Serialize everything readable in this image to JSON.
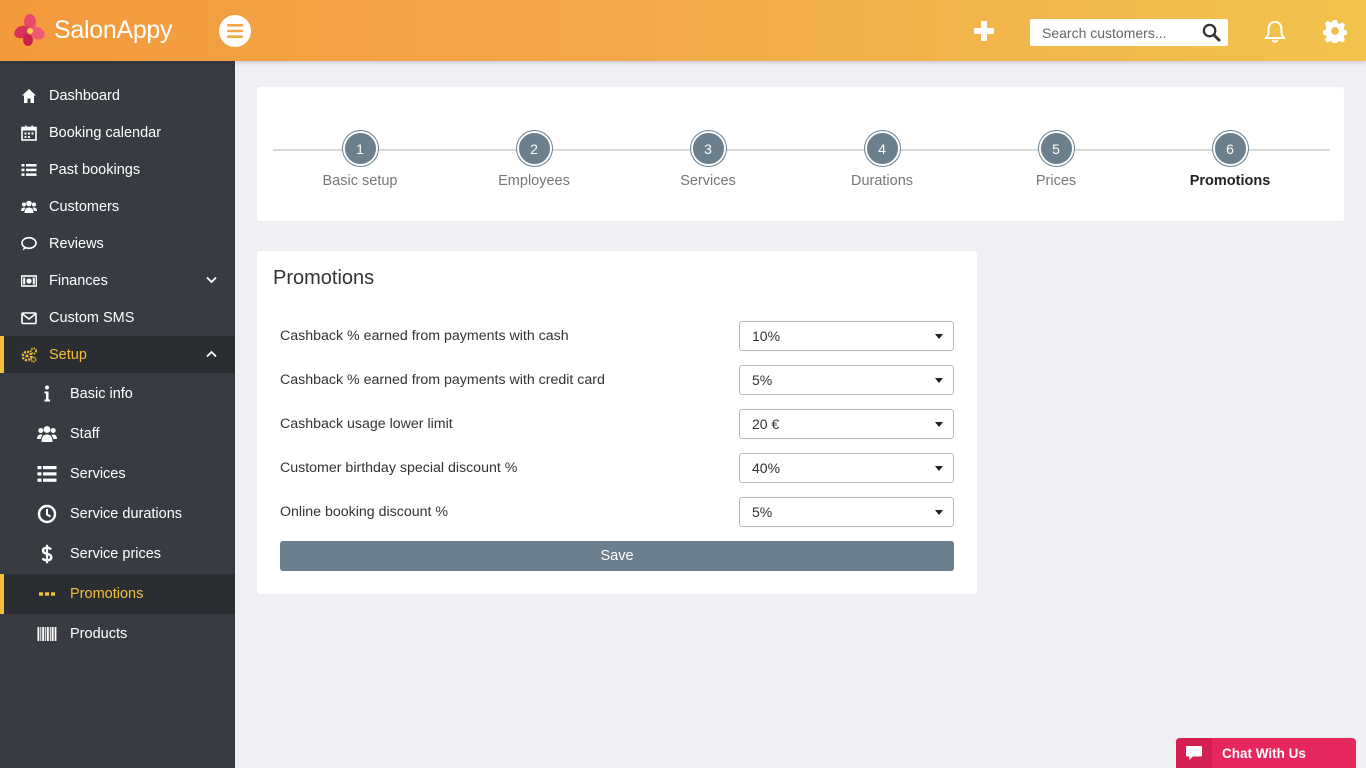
{
  "header": {
    "brand": "SalonAppy",
    "search_placeholder": "Search customers...",
    "icons": {
      "menu": "hamburger-icon",
      "add": "plus-icon",
      "search": "search-icon",
      "notifications": "bell-icon",
      "settings": "gear-icon"
    },
    "colors": {
      "gradient_start": "#f39a3c",
      "gradient_end": "#f2c34d"
    }
  },
  "sidebar": {
    "items": [
      {
        "label": "Dashboard",
        "icon": "home-icon"
      },
      {
        "label": "Booking calendar",
        "icon": "calendar-icon"
      },
      {
        "label": "Past bookings",
        "icon": "list-icon"
      },
      {
        "label": "Customers",
        "icon": "users-icon"
      },
      {
        "label": "Reviews",
        "icon": "comment-icon"
      },
      {
        "label": "Finances",
        "icon": "money-icon"
      },
      {
        "label": "Custom SMS",
        "icon": "envelope-icon"
      },
      {
        "label": "Setup",
        "icon": "cogs-icon"
      }
    ],
    "sub_items": [
      {
        "label": "Basic info",
        "icon": "info-icon"
      },
      {
        "label": "Staff",
        "icon": "users-icon"
      },
      {
        "label": "Services",
        "icon": "list-icon"
      },
      {
        "label": "Service durations",
        "icon": "clock-icon"
      },
      {
        "label": "Service prices",
        "icon": "dollar-icon"
      },
      {
        "label": "Promotions",
        "icon": "ellipsis-icon"
      },
      {
        "label": "Products",
        "icon": "barcode-icon"
      }
    ],
    "active_color": "#f4bf3a"
  },
  "stepper": {
    "steps": [
      {
        "number": "1",
        "label": "Basic setup"
      },
      {
        "number": "2",
        "label": "Employees"
      },
      {
        "number": "3",
        "label": "Services"
      },
      {
        "number": "4",
        "label": "Durations"
      },
      {
        "number": "5",
        "label": "Prices"
      },
      {
        "number": "6",
        "label": "Promotions"
      }
    ],
    "current": "Promotions"
  },
  "promotions": {
    "title": "Promotions",
    "rows": [
      {
        "label": "Cashback % earned from payments with cash",
        "value": "10%"
      },
      {
        "label": "Cashback % earned from payments with credit card",
        "value": "5%"
      },
      {
        "label": "Cashback usage lower limit",
        "value": "20 €"
      },
      {
        "label": "Customer birthday special discount %",
        "value": "40%"
      },
      {
        "label": "Online booking discount %",
        "value": "5%"
      }
    ],
    "save_label": "Save",
    "button_color": "#6b7f8c"
  },
  "chat": {
    "label": "Chat With Us",
    "color": "#e8265e"
  }
}
